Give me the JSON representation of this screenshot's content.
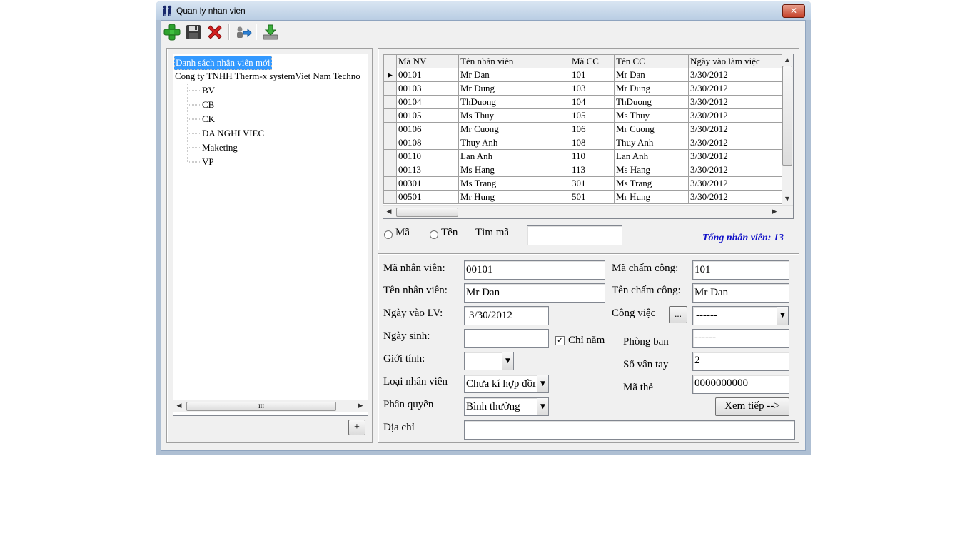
{
  "window": {
    "title": "Quan ly nhan vien",
    "close_label": "✕"
  },
  "toolbar": {
    "add": "add-icon",
    "save": "save-icon",
    "delete": "delete-icon",
    "export": "export-icon",
    "import": "download-icon"
  },
  "tree": {
    "root_selected": "Danh sách nhân viên mới",
    "company": "Cong ty TNHH Therm-x systemViet Nam Techno",
    "children": [
      "BV",
      "CB",
      "CK",
      "DA NGHI VIEC",
      "Maketing",
      "VP"
    ],
    "scroll_thumb_label": "III",
    "plus_label": "+"
  },
  "grid": {
    "columns": [
      "Mã NV",
      "Tên nhân viên",
      "Mã CC",
      "Tên CC",
      "Ngày vào làm việc"
    ],
    "rows": [
      [
        "00101",
        "Mr Dan",
        "101",
        "Mr Dan",
        "3/30/2012"
      ],
      [
        "00103",
        "Mr Dung",
        "103",
        "Mr Dung",
        "3/30/2012"
      ],
      [
        "00104",
        "ThDuong",
        "104",
        "ThDuong",
        "3/30/2012"
      ],
      [
        "00105",
        "Ms Thuy",
        "105",
        "Ms Thuy",
        "3/30/2012"
      ],
      [
        "00106",
        "Mr Cuong",
        "106",
        "Mr Cuong",
        "3/30/2012"
      ],
      [
        "00108",
        "Thuy Anh",
        "108",
        "Thuy Anh",
        "3/30/2012"
      ],
      [
        "00110",
        "Lan Anh",
        "110",
        "Lan Anh",
        "3/30/2012"
      ],
      [
        "00113",
        "Ms Hang",
        "113",
        "Ms Hang",
        "3/30/2012"
      ],
      [
        "00301",
        "Ms Trang",
        "301",
        "Ms Trang",
        "3/30/2012"
      ],
      [
        "00501",
        "Mr Hung",
        "501",
        "Mr Hung",
        "3/30/2012"
      ]
    ],
    "current_row_marker": "▶"
  },
  "search": {
    "radio_ma": "Mã",
    "radio_ten": "Tên",
    "find_label": "Tìm mã",
    "find_value": "",
    "total": "Tổng nhân viên: 13"
  },
  "form": {
    "ma_nv_label": "Mã nhân viên:",
    "ma_nv_value": "00101",
    "ten_nv_label": "Tên nhân viên:",
    "ten_nv_value": "Mr Dan",
    "ngay_vao_label": "Ngày vào LV:",
    "ngay_vao_value": "3/30/2012",
    "ngay_sinh_label": "Ngày sinh:",
    "ngay_sinh_value": "",
    "chi_nam_label": "Chỉ năm",
    "chi_nam_check": "✓",
    "gioi_tinh_label": "Giới tính:",
    "gioi_tinh_value": "",
    "loai_nv_label": "Loại nhân viên",
    "loai_nv_value": "Chưa kí hợp đồng",
    "phan_quyen_label": "Phân quyền",
    "phan_quyen_value": "Bình thường",
    "dia_chi_label": "Địa chỉ",
    "dia_chi_value": "",
    "ma_cc_label": "Mã chấm công:",
    "ma_cc_value": "101",
    "ten_cc_label": "Tên chấm công:",
    "ten_cc_value": "Mr Dan",
    "cong_viec_label": "Công việc",
    "cong_viec_btn": "...",
    "cong_viec_value": "------",
    "phong_ban_label": "Phòng ban",
    "phong_ban_value": "------",
    "so_van_tay_label": "Số vân tay",
    "so_van_tay_value": "2",
    "ma_the_label": "Mã thẻ",
    "ma_the_value": "0000000000",
    "xem_tiep_label": "Xem tiếp -->",
    "dropdown_arrow": "▼"
  }
}
